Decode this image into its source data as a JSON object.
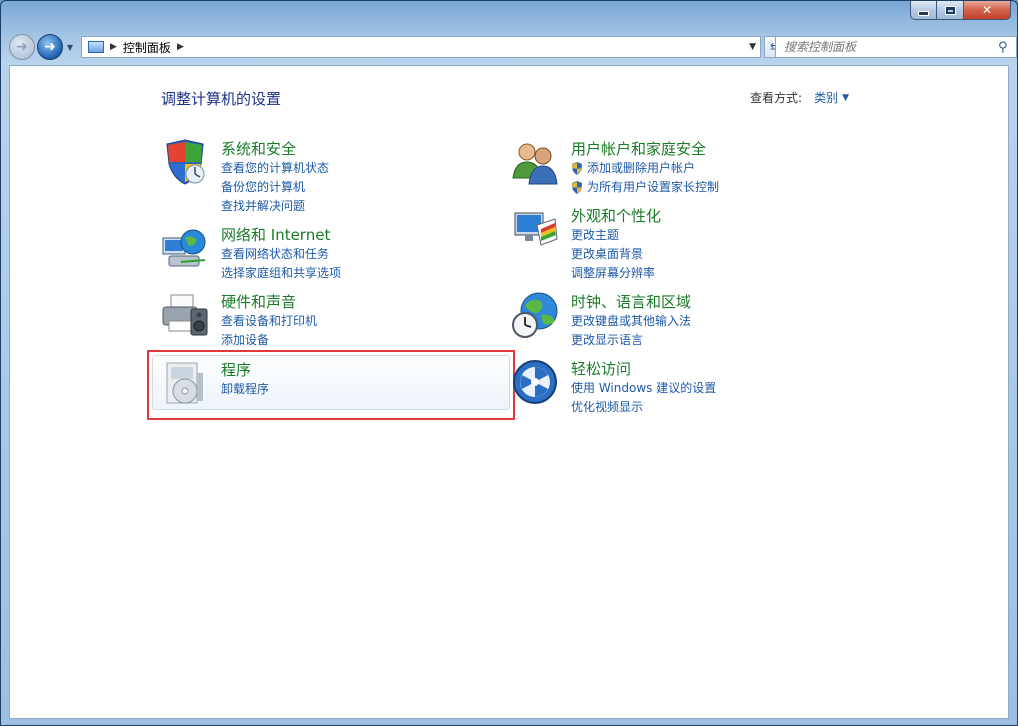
{
  "titlebar": {
    "buttons": {
      "minimize": "minimize",
      "maximize": "maximize",
      "close": "close"
    }
  },
  "nav": {
    "address": [
      "控制面板"
    ],
    "search_placeholder": "搜索控制面板"
  },
  "content": {
    "title": "调整计算机的设置",
    "view_by_label": "查看方式:",
    "view_by_value": "类别",
    "categories": [
      {
        "title": "系统和安全",
        "icon": "shield-icon",
        "links": [
          "查看您的计算机状态",
          "备份您的计算机",
          "查找并解决问题"
        ]
      },
      {
        "title": "网络和 Internet",
        "icon": "network-globe-icon",
        "links": [
          "查看网络状态和任务",
          "选择家庭组和共享选项"
        ]
      },
      {
        "title": "硬件和声音",
        "icon": "printer-speaker-icon",
        "links": [
          "查看设备和打印机",
          "添加设备"
        ]
      },
      {
        "title": "程序",
        "icon": "programs-disc-icon",
        "links": [
          "卸载程序"
        ]
      },
      {
        "title": "用户帐户和家庭安全",
        "icon": "users-icon",
        "links": [
          "添加或删除用户帐户",
          "为所有用户设置家长控制"
        ]
      },
      {
        "title": "外观和个性化",
        "icon": "monitor-palette-icon",
        "links": [
          "更改主题",
          "更改桌面背景",
          "调整屏幕分辨率"
        ]
      },
      {
        "title": "时钟、语言和区域",
        "icon": "clock-globe-icon",
        "links": [
          "更改键盘或其他输入法",
          "更改显示语言"
        ]
      },
      {
        "title": "轻松访问",
        "icon": "ease-of-access-icon",
        "links": [
          "使用 Windows 建议的设置",
          "优化视频显示"
        ]
      }
    ]
  },
  "colors": {
    "title_green": "#1a7c27",
    "link_blue": "#1e5aa8",
    "heading_blue": "#1e3287",
    "highlight_red": "#e0393c"
  }
}
